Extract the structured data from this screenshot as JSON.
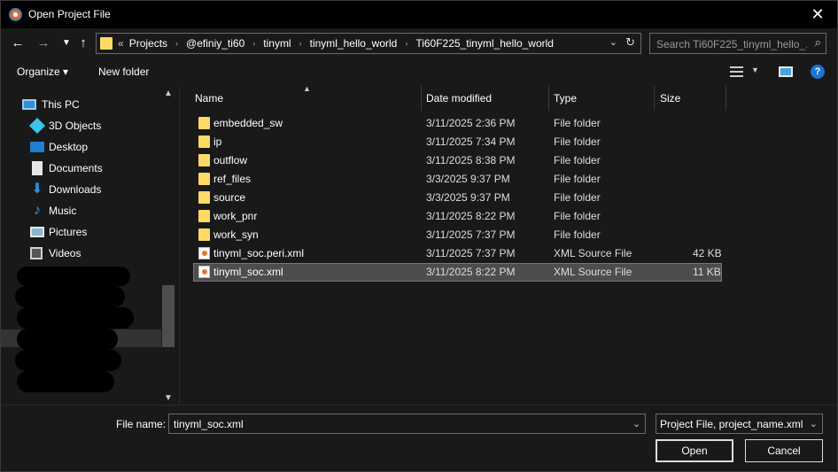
{
  "window": {
    "title": "Open Project File"
  },
  "nav": {
    "back_icon": "back-arrow-icon",
    "forward_icon": "forward-arrow-icon",
    "recent_icon": "chevron-down-icon",
    "up_icon": "up-arrow-icon"
  },
  "address": {
    "overflow": "«",
    "crumbs": [
      "Projects",
      "@efiniy_ti60",
      "tinyml",
      "tinyml_hello_world",
      "Ti60F225_tinyml_hello_world"
    ]
  },
  "search": {
    "placeholder": "Search Ti60F225_tinyml_hello_..."
  },
  "toolbar": {
    "organize": "Organize ▾",
    "new_folder": "New folder",
    "help": "?"
  },
  "sidebar": {
    "items": [
      {
        "label": "This PC",
        "icon": "computer-icon"
      },
      {
        "label": "3D Objects",
        "icon": "cube-icon"
      },
      {
        "label": "Desktop",
        "icon": "desktop-icon"
      },
      {
        "label": "Documents",
        "icon": "document-icon"
      },
      {
        "label": "Downloads",
        "icon": "download-icon"
      },
      {
        "label": "Music",
        "icon": "music-icon"
      },
      {
        "label": "Pictures",
        "icon": "picture-icon"
      },
      {
        "label": "Videos",
        "icon": "video-icon"
      }
    ]
  },
  "columns": {
    "name": "Name",
    "date": "Date modified",
    "type": "Type",
    "size": "Size"
  },
  "files": [
    {
      "name": "embedded_sw",
      "date": "3/11/2025 2:36 PM",
      "type": "File folder",
      "size": "",
      "kind": "folder"
    },
    {
      "name": "ip",
      "date": "3/11/2025 7:34 PM",
      "type": "File folder",
      "size": "",
      "kind": "folder"
    },
    {
      "name": "outflow",
      "date": "3/11/2025 8:38 PM",
      "type": "File folder",
      "size": "",
      "kind": "folder"
    },
    {
      "name": "ref_files",
      "date": "3/3/2025 9:37 PM",
      "type": "File folder",
      "size": "",
      "kind": "folder"
    },
    {
      "name": "source",
      "date": "3/3/2025 9:37 PM",
      "type": "File folder",
      "size": "",
      "kind": "folder"
    },
    {
      "name": "work_pnr",
      "date": "3/11/2025 8:22 PM",
      "type": "File folder",
      "size": "",
      "kind": "folder"
    },
    {
      "name": "work_syn",
      "date": "3/11/2025 7:37 PM",
      "type": "File folder",
      "size": "",
      "kind": "folder"
    },
    {
      "name": "tinyml_soc.peri.xml",
      "date": "3/11/2025 7:37 PM",
      "type": "XML Source File",
      "size": "42 KB",
      "kind": "xml"
    },
    {
      "name": "tinyml_soc.xml",
      "date": "3/11/2025 8:22 PM",
      "type": "XML Source File",
      "size": "11 KB",
      "kind": "xml",
      "selected": true
    }
  ],
  "footer": {
    "filename_label": "File name:",
    "filename_value": "tinyml_soc.xml",
    "filetype_value": "Project File, project_name.xml (",
    "open": "Open",
    "cancel": "Cancel"
  }
}
